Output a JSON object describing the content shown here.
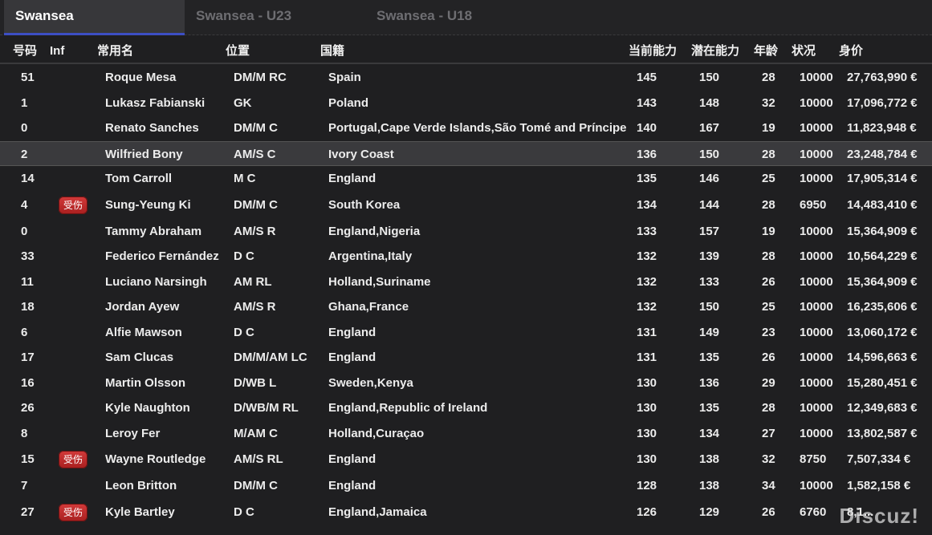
{
  "tabs": [
    {
      "label": "Swansea",
      "active": true
    },
    {
      "label": "Swansea - U23",
      "active": false
    },
    {
      "label": "Swansea - U18",
      "active": false
    }
  ],
  "columns": {
    "number": "号码",
    "inf": "Inf",
    "name": "常用名",
    "position": "位置",
    "nationality": "国籍",
    "current_ability": "当前能力",
    "potential_ability": "潜在能力",
    "age": "年龄",
    "condition": "状况",
    "value": "身价"
  },
  "injury_label": "受伤",
  "players": [
    {
      "number": "51",
      "inf": "",
      "name": "Roque Mesa",
      "position": "DM/M RC",
      "nationality": "Spain",
      "ca": "145",
      "pa": "150",
      "age": "28",
      "condition": "10000",
      "value": "27,763,990 €"
    },
    {
      "number": "1",
      "inf": "",
      "name": "Lukasz Fabianski",
      "position": "GK",
      "nationality": "Poland",
      "ca": "143",
      "pa": "148",
      "age": "32",
      "condition": "10000",
      "value": "17,096,772 €"
    },
    {
      "number": "0",
      "inf": "",
      "name": "Renato Sanches",
      "position": "DM/M C",
      "nationality": "Portugal,Cape Verde Islands,São Tomé and Príncipe",
      "ca": "140",
      "pa": "167",
      "age": "19",
      "condition": "10000",
      "value": "11,823,948 €"
    },
    {
      "number": "2",
      "inf": "",
      "name": "Wilfried Bony",
      "position": "AM/S C",
      "nationality": "Ivory Coast",
      "ca": "136",
      "pa": "150",
      "age": "28",
      "condition": "10000",
      "value": "23,248,784 €",
      "selected": true
    },
    {
      "number": "14",
      "inf": "",
      "name": "Tom Carroll",
      "position": "M C",
      "nationality": "England",
      "ca": "135",
      "pa": "146",
      "age": "25",
      "condition": "10000",
      "value": "17,905,314 €"
    },
    {
      "number": "4",
      "inf": "受伤",
      "name": "Sung-Yeung Ki",
      "position": "DM/M C",
      "nationality": "South Korea",
      "ca": "134",
      "pa": "144",
      "age": "28",
      "condition": "6950",
      "value": "14,483,410 €"
    },
    {
      "number": "0",
      "inf": "",
      "name": "Tammy Abraham",
      "position": "AM/S R",
      "nationality": "England,Nigeria",
      "ca": "133",
      "pa": "157",
      "age": "19",
      "condition": "10000",
      "value": "15,364,909 €"
    },
    {
      "number": "33",
      "inf": "",
      "name": "Federico Fernández",
      "position": "D C",
      "nationality": "Argentina,Italy",
      "ca": "132",
      "pa": "139",
      "age": "28",
      "condition": "10000",
      "value": "10,564,229 €"
    },
    {
      "number": "11",
      "inf": "",
      "name": "Luciano Narsingh",
      "position": "AM RL",
      "nationality": "Holland,Suriname",
      "ca": "132",
      "pa": "133",
      "age": "26",
      "condition": "10000",
      "value": "15,364,909 €"
    },
    {
      "number": "18",
      "inf": "",
      "name": "Jordan Ayew",
      "position": "AM/S R",
      "nationality": "Ghana,France",
      "ca": "132",
      "pa": "150",
      "age": "25",
      "condition": "10000",
      "value": "16,235,606 €"
    },
    {
      "number": "6",
      "inf": "",
      "name": "Alfie Mawson",
      "position": "D C",
      "nationality": "England",
      "ca": "131",
      "pa": "149",
      "age": "23",
      "condition": "10000",
      "value": "13,060,172 €"
    },
    {
      "number": "17",
      "inf": "",
      "name": "Sam Clucas",
      "position": "DM/M/AM LC",
      "nationality": "England",
      "ca": "131",
      "pa": "135",
      "age": "26",
      "condition": "10000",
      "value": "14,596,663 €"
    },
    {
      "number": "16",
      "inf": "",
      "name": "Martin Olsson",
      "position": "D/WB L",
      "nationality": "Sweden,Kenya",
      "ca": "130",
      "pa": "136",
      "age": "29",
      "condition": "10000",
      "value": "15,280,451 €"
    },
    {
      "number": "26",
      "inf": "",
      "name": "Kyle Naughton",
      "position": "D/WB/M RL",
      "nationality": "England,Republic of Ireland",
      "ca": "130",
      "pa": "135",
      "age": "28",
      "condition": "10000",
      "value": "12,349,683 €"
    },
    {
      "number": "8",
      "inf": "",
      "name": "Leroy Fer",
      "position": "M/AM C",
      "nationality": "Holland,Curaçao",
      "ca": "130",
      "pa": "134",
      "age": "27",
      "condition": "10000",
      "value": "13,802,587 €"
    },
    {
      "number": "15",
      "inf": "受伤",
      "name": "Wayne Routledge",
      "position": "AM/S RL",
      "nationality": "England",
      "ca": "130",
      "pa": "138",
      "age": "32",
      "condition": "8750",
      "value": "7,507,334 €"
    },
    {
      "number": "7",
      "inf": "",
      "name": "Leon Britton",
      "position": "DM/M C",
      "nationality": "England",
      "ca": "128",
      "pa": "138",
      "age": "34",
      "condition": "10000",
      "value": "1,582,158 €"
    },
    {
      "number": "27",
      "inf": "受伤",
      "name": "Kyle Bartley",
      "position": "D C",
      "nationality": "England,Jamaica",
      "ca": "126",
      "pa": "129",
      "age": "26",
      "condition": "6760",
      "value": "8,1..."
    }
  ],
  "watermark": "Discuz!"
}
